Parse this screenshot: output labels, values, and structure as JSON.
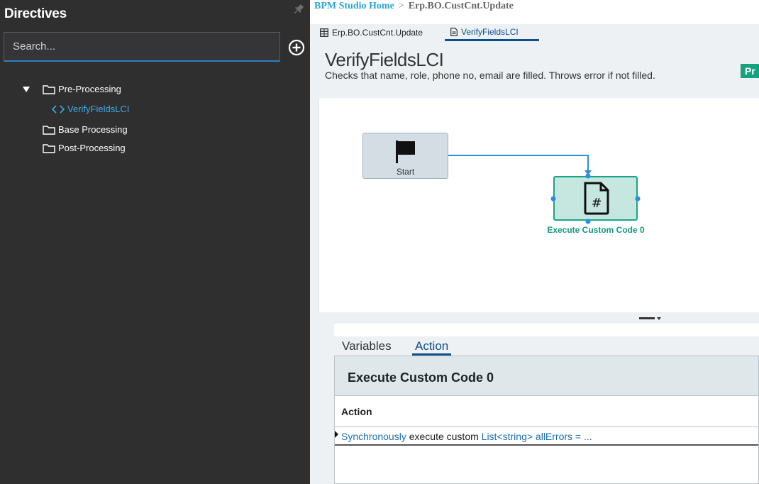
{
  "sidebar": {
    "title": "Directives",
    "search_placeholder": "Search...",
    "tree": [
      {
        "label": "Pre-Processing",
        "expanded": true,
        "children": [
          {
            "label": "VerifyFieldsLCI",
            "selected": true
          }
        ]
      },
      {
        "label": "Base Processing"
      },
      {
        "label": "Post-Processing"
      }
    ]
  },
  "breadcrumb": {
    "home": "BPM Studio Home",
    "separator": ">",
    "current": "Erp.BO.CustCnt.Update"
  },
  "tabs": [
    {
      "label": "Erp.BO.CustCnt.Update",
      "icon": "table-icon"
    },
    {
      "label": "VerifyFieldsLCI",
      "icon": "document-icon",
      "active": true
    }
  ],
  "header": {
    "title": "VerifyFieldsLCI",
    "description": "Checks that name, role, phone no, email are filled. Throws error if not filled.",
    "badge": "Pr"
  },
  "workflow": {
    "start_label": "Start",
    "exec_label": "Execute Custom Code 0"
  },
  "bottom": {
    "tabs": [
      "Variables",
      "Action"
    ],
    "active_tab": "Action",
    "panel_title": "Execute Custom Code 0",
    "column": "Action",
    "row": {
      "part1": "Synchronously",
      "part2": " execute custom ",
      "part3": "List<string> allErrors = ..."
    }
  },
  "colors": {
    "sidebar_bg": "#2f2f30",
    "accent_blue": "#0d4f8b",
    "accent_teal": "#19a58a",
    "link": "#2aa5d6"
  }
}
